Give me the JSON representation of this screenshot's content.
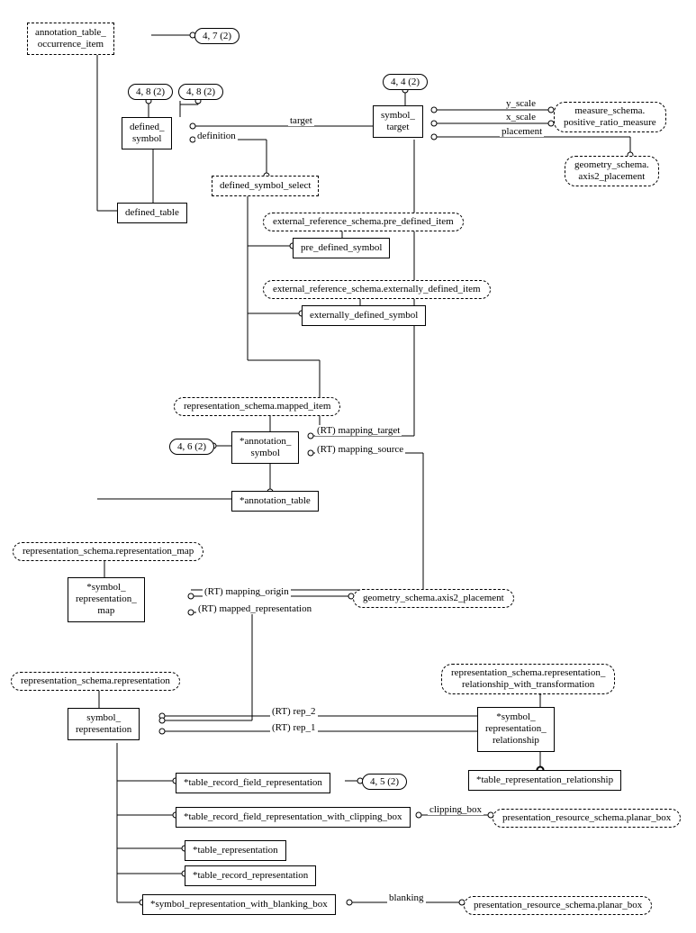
{
  "pagerefs": {
    "p47_2": "4, 7 (2)",
    "p48_2a": "4, 8 (2)",
    "p48_2b": "4, 8 (2)",
    "p44_2": "4, 4 (2)",
    "p46_2": "4, 6 (2)",
    "p45_2": "4, 5 (2)"
  },
  "entities": {
    "annotation_table_occurrence_item": "annotation_table_\noccurrence_item",
    "defined_symbol": "defined_\nsymbol",
    "symbol_target": "symbol_\ntarget",
    "defined_table": "defined_table",
    "defined_symbol_select": "defined_symbol_select",
    "pre_defined_symbol": "pre_defined_symbol",
    "externally_defined_symbol": "externally_defined_symbol",
    "annotation_symbol": "*annotation_\nsymbol",
    "annotation_table": "*annotation_table",
    "symbol_representation_map": "*symbol_\nrepresentation_\nmap",
    "symbol_representation": "symbol_\nrepresentation",
    "symbol_representation_relationship": "*symbol_\nrepresentation_\nrelationship",
    "table_representation_relationship": "*table_representation_relationship",
    "table_record_field_representation": "*table_record_field_representation",
    "table_record_field_representation_with_clipping_box": "*table_record_field_representation_with_clipping_box",
    "table_representation": "*table_representation",
    "table_record_representation": "*table_record_representation",
    "symbol_representation_with_blanking_box": "*symbol_representation_with_blanking_box"
  },
  "references": {
    "measure_positive_ratio": "measure_schema.\npositive_ratio_measure",
    "geometry_axis2_placement_a": "geometry_schema.\naxis2_placement",
    "geometry_axis2_placement_b": "geometry_schema.axis2_placement",
    "external_pre_defined_item": "external_reference_schema.pre_defined_item",
    "external_externally_defined_item": "external_reference_schema.externally_defined_item",
    "representation_mapped_item": "representation_schema.mapped_item",
    "representation_map": "representation_schema.representation_map",
    "representation_representation": "representation_schema.representation",
    "representation_rel_with_transform": "representation_schema.representation_\nrelationship_with_transformation",
    "presentation_planar_box_a": "presentation_resource_schema.planar_box",
    "presentation_planar_box_b": "presentation_resource_schema.planar_box"
  },
  "labels": {
    "target": "target",
    "definition": "definition",
    "y_scale": "y_scale",
    "x_scale": "x_scale",
    "placement": "placement",
    "rt_mapping_target": "(RT) mapping_target",
    "rt_mapping_source": "(RT) mapping_source",
    "rt_mapping_origin": "(RT) mapping_origin",
    "rt_mapped_representation": "(RT) mapped_representation",
    "rt_rep_2": "(RT) rep_2",
    "rt_rep_1": "(RT) rep_1",
    "clipping_box": "clipping_box",
    "blanking": "blanking"
  }
}
